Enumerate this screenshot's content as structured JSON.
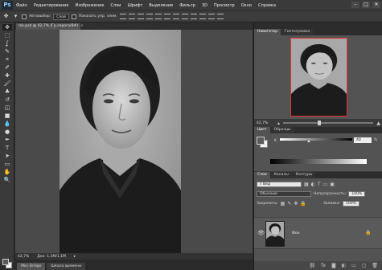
{
  "app": {
    "logo": "Ps",
    "menu": [
      "Файл",
      "Редактирование",
      "Изображение",
      "Слои",
      "Шрифт",
      "Выделение",
      "Фильтр",
      "3D",
      "Просмотр",
      "Окно",
      "Справка"
    ],
    "window_controls": [
      "–",
      "□",
      "✕"
    ]
  },
  "options_bar": {
    "tool_icon": "move-tool-icon",
    "auto_select_label": "Автовыбор:",
    "auto_select_value": "Слой",
    "show_transform_label": "Показать упр. элем."
  },
  "tools": [
    "move",
    "marquee",
    "lasso",
    "quick-select",
    "crop",
    "eyedropper",
    "healing-brush",
    "brush",
    "clone-stamp",
    "history-brush",
    "eraser",
    "gradient",
    "blur",
    "dodge",
    "pen",
    "type",
    "path-select",
    "shape",
    "hand",
    "zoom"
  ],
  "tool_glyphs": [
    "✥",
    "⬚",
    "ʆ",
    "✎",
    "⌗",
    "✐",
    "✚",
    "🖌",
    "♣",
    "↺",
    "◫",
    "■",
    "💧",
    "●",
    "✒",
    "T",
    "➤",
    "▭",
    "✋",
    "🔍"
  ],
  "document": {
    "tab_title": "ros.psd @ 42,7% (Гр.серого/8#)",
    "tab_close": "×",
    "zoom": "42,7%",
    "doc_info": "Док: 1,1М/1,1М"
  },
  "bottom_tabs": [
    "Mini Bridge",
    "Шкала времени"
  ],
  "navigator": {
    "tabs": [
      "Навигатор",
      "Гистограмма"
    ],
    "zoom": "42,7%"
  },
  "color_panel": {
    "tabs": [
      "Цвет",
      "Образцы"
    ],
    "channel_label": "K",
    "value": "40",
    "unit": "%",
    "k_fraction": 0.4
  },
  "layers_panel": {
    "tabs": [
      "Слои",
      "Каналы",
      "Контуры"
    ],
    "filter_label": "Вид",
    "blend_mode": "Обычные",
    "opacity_label": "Непрозрачность:",
    "opacity_value": "100%",
    "lock_label": "Закрепить:",
    "fill_label": "Заливка:",
    "fill_value": "100%",
    "layer_name": "Фон"
  },
  "colors": {
    "foreground": "#5a5a5a",
    "background": "#f2f2f2"
  }
}
